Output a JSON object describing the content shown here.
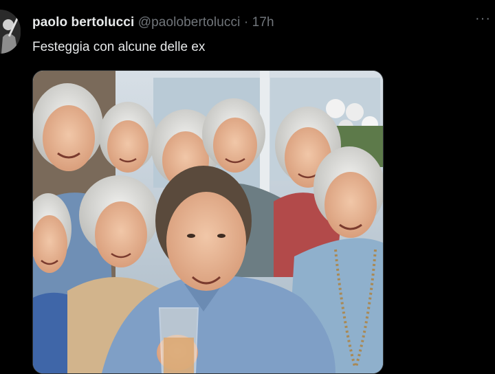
{
  "tweet": {
    "display_name": "paolo bertolucci",
    "handle": "@paolobertolucci",
    "separator": "·",
    "time": "17h",
    "text": "Festeggia con alcune delle ex",
    "more_icon": "more-horizontal-icon"
  },
  "media": {
    "kind": "photo",
    "subject": "man raising a glass surrounded by elderly women"
  },
  "colors": {
    "background": "#000000",
    "primary_text": "#e7e9ea",
    "secondary_text": "#71767b",
    "border": "#2f3336"
  }
}
